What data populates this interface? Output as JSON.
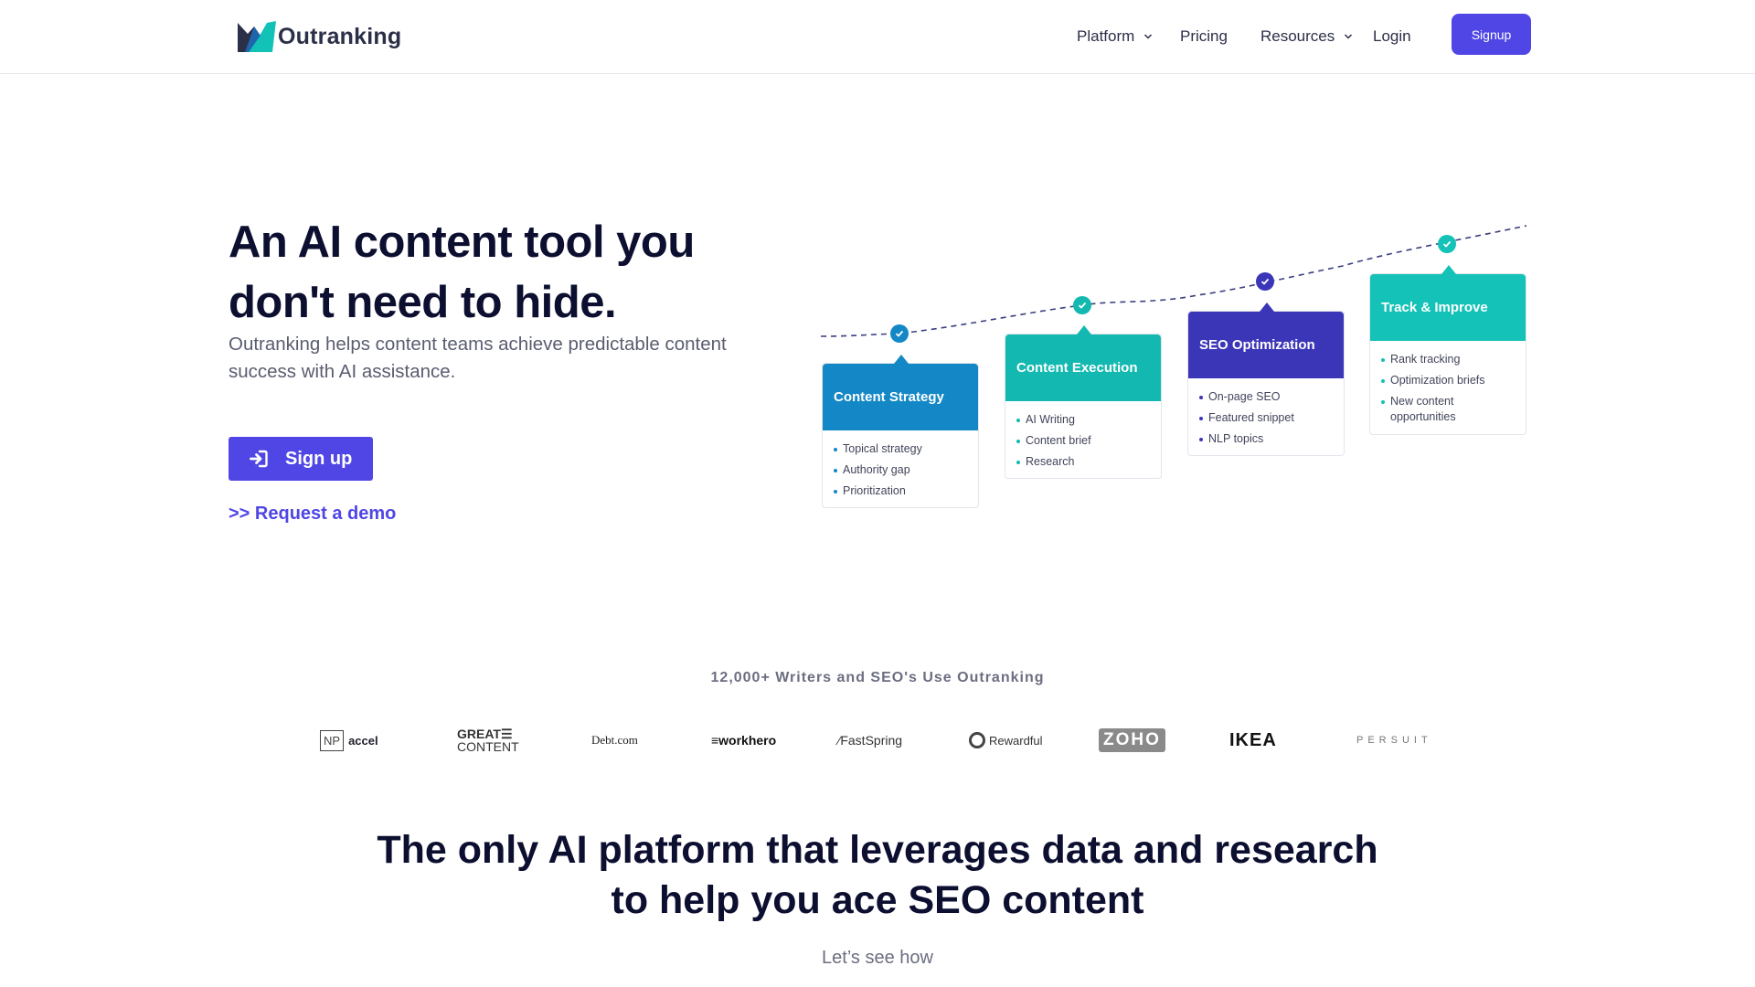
{
  "header": {
    "brand": "Outranking",
    "nav": [
      {
        "label": "Platform",
        "has_dropdown": true
      },
      {
        "label": "Pricing",
        "has_dropdown": false
      },
      {
        "label": "Resources",
        "has_dropdown": true
      },
      {
        "label": "Login",
        "has_dropdown": false
      }
    ],
    "signup_label": "Signup"
  },
  "hero": {
    "title_line1": "An AI content tool you",
    "title_line2": "don't need to hide.",
    "subtitle": "Outranking helps content teams achieve predictable content success with AI assistance.",
    "cta_label": "Sign up",
    "demo_label": ">> Request a demo"
  },
  "steps": [
    {
      "title": "Content Strategy",
      "color": "#1488c6",
      "items": [
        "Topical strategy",
        "Authority gap",
        "Prioritization"
      ]
    },
    {
      "title": "Content Execution",
      "color": "#13b9b0",
      "items": [
        "AI Writing",
        "Content brief",
        "Research"
      ]
    },
    {
      "title": "SEO Optimization",
      "color": "#3b35b8",
      "items": [
        "On-page SEO",
        "Featured snippet",
        "NLP topics"
      ]
    },
    {
      "title": "Track & Improve",
      "color": "#14c2b8",
      "items": [
        "Rank tracking",
        "Optimization briefs",
        "New content opportunities"
      ]
    }
  ],
  "social_proof": {
    "headline": "12,000+ Writers and SEO's Use Outranking",
    "logos": [
      "NP accel",
      "GREAT CONTENT",
      "Debt.com",
      "workhero",
      "FastSpring",
      "Rewardful",
      "ZOHO",
      "IKEA",
      "PERSUIT"
    ]
  },
  "section2": {
    "title_line1": "The only AI platform that leverages data and research",
    "title_line2": "to help you ace SEO content",
    "subtitle": "Let’s see how"
  },
  "colors": {
    "primary": "#4f46e5",
    "heading": "#0d0f30",
    "body_text": "#5a5d70"
  }
}
